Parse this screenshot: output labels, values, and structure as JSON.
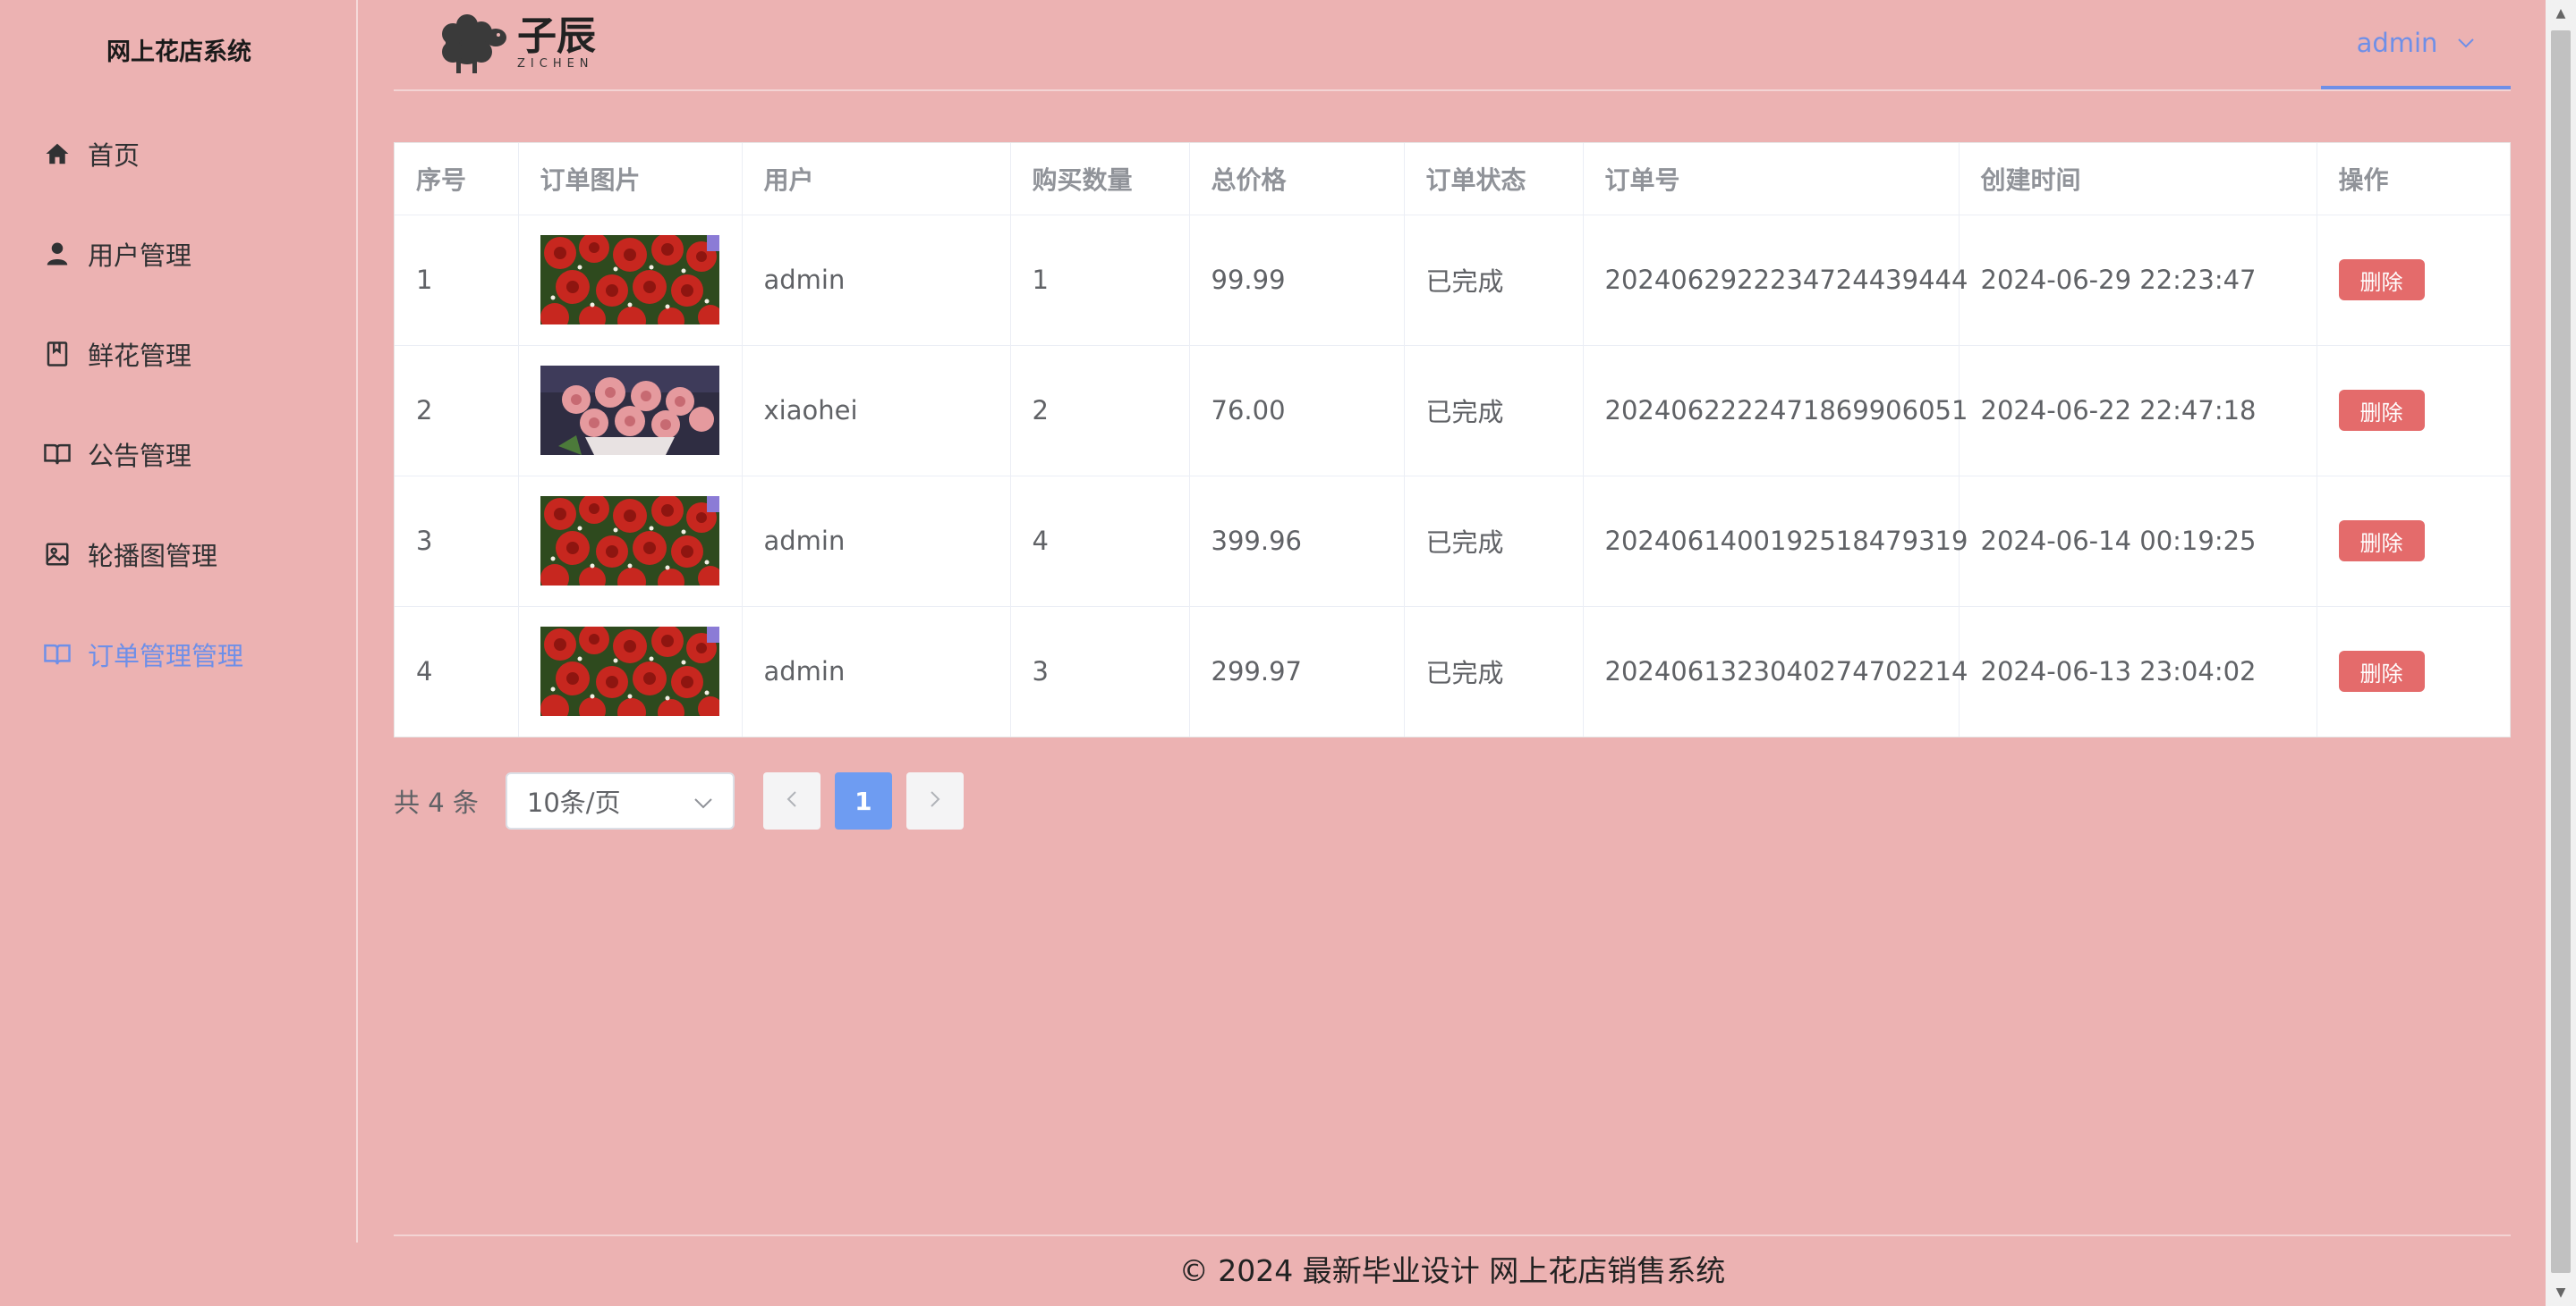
{
  "app_title": "网上花店系统",
  "sidebar": {
    "items": [
      {
        "label": "首页",
        "icon": "home-icon"
      },
      {
        "label": "用户管理",
        "icon": "user-icon"
      },
      {
        "label": "鲜花管理",
        "icon": "book-icon"
      },
      {
        "label": "公告管理",
        "icon": "open-book-icon"
      },
      {
        "label": "轮播图管理",
        "icon": "image-icon"
      },
      {
        "label": "订单管理管理",
        "icon": "open-book-icon",
        "active": true
      }
    ]
  },
  "header": {
    "logo_cn": "子辰",
    "logo_en": "ZICHEN",
    "user": "admin"
  },
  "table": {
    "columns": [
      "序号",
      "订单图片",
      "用户",
      "购买数量",
      "总价格",
      "订单状态",
      "订单号",
      "创建时间",
      "操作"
    ],
    "rows": [
      {
        "index": "1",
        "image": "red-roses",
        "user": "admin",
        "qty": "1",
        "price": "99.99",
        "status": "已完成",
        "order_no": "2024062922234724439444",
        "created": "2024-06-29 22:23:47",
        "action": "删除"
      },
      {
        "index": "2",
        "image": "pink-roses",
        "user": "xiaohei",
        "qty": "2",
        "price": "76.00",
        "status": "已完成",
        "order_no": "2024062222471869906051",
        "created": "2024-06-22 22:47:18",
        "action": "删除"
      },
      {
        "index": "3",
        "image": "red-roses",
        "user": "admin",
        "qty": "4",
        "price": "399.96",
        "status": "已完成",
        "order_no": "2024061400192518479319",
        "created": "2024-06-14 00:19:25",
        "action": "删除"
      },
      {
        "index": "4",
        "image": "red-roses",
        "user": "admin",
        "qty": "3",
        "price": "299.97",
        "status": "已完成",
        "order_no": "2024061323040274702214",
        "created": "2024-06-13 23:04:02",
        "action": "删除"
      }
    ]
  },
  "pagination": {
    "total": "共 4 条",
    "page_size": "10条/页",
    "current_page": "1",
    "prev_icon": "chevron-left-icon",
    "next_icon": "chevron-right-icon"
  },
  "footer": "© 2024 最新毕业设计 网上花店销售系统",
  "colors": {
    "background": "#ecb2b2",
    "accent": "#6e8fe8",
    "danger": "#e46b6b"
  }
}
